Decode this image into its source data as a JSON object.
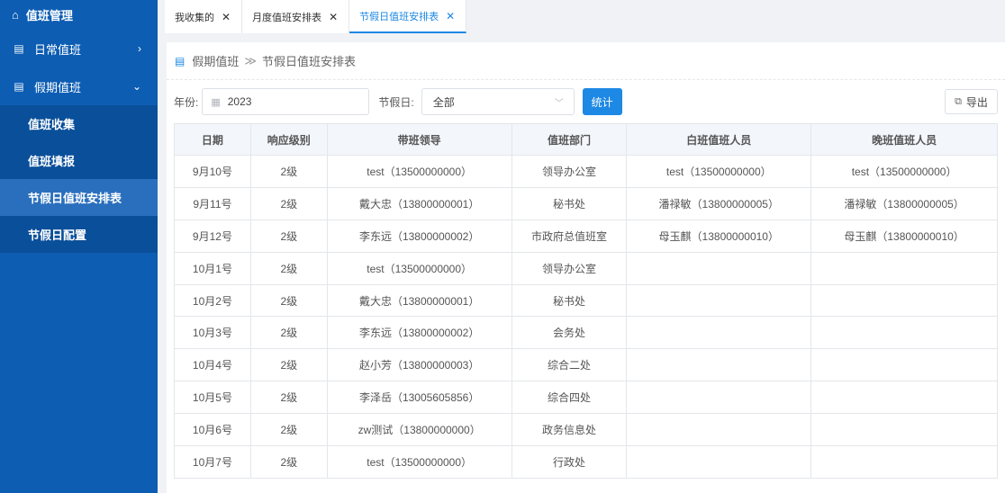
{
  "sidebar": {
    "title": "值班管理",
    "items": [
      {
        "label": "日常值班",
        "arrow": "›"
      },
      {
        "label": "假期值班",
        "arrow": "⌄"
      }
    ],
    "subitems": [
      {
        "label": "值班收集"
      },
      {
        "label": "值班填报"
      },
      {
        "label": "节假日值班安排表"
      },
      {
        "label": "节假日配置"
      }
    ]
  },
  "tabs": [
    {
      "label": "我收集的",
      "close": "✕"
    },
    {
      "label": "月度值班安排表",
      "close": "✕"
    },
    {
      "label": "节假日值班安排表",
      "close": "✕"
    }
  ],
  "breadcrumb": {
    "parent": "假期值班",
    "sep": "≫",
    "current": "节假日值班安排表"
  },
  "filters": {
    "year_label": "年份:",
    "year_value": "2023",
    "holiday_label": "节假日:",
    "holiday_value": "全部",
    "stat_button": "统计",
    "export_button": "导出"
  },
  "table": {
    "headers": [
      "日期",
      "响应级别",
      "带班领导",
      "值班部门",
      "白班值班人员",
      "晚班值班人员"
    ],
    "rows": [
      [
        "9月10号",
        "2级",
        "test（13500000000）",
        "领导办公室",
        "test（13500000000）",
        "test（13500000000）"
      ],
      [
        "9月11号",
        "2级",
        "戴大忠（13800000001）",
        "秘书处",
        "潘禄敏（13800000005）",
        "潘禄敏（13800000005）"
      ],
      [
        "9月12号",
        "2级",
        "李东远（13800000002）",
        "市政府总值班室",
        "母玉麒（13800000010）",
        "母玉麒（13800000010）"
      ],
      [
        "10月1号",
        "2级",
        "test（13500000000）",
        "领导办公室",
        "",
        ""
      ],
      [
        "10月2号",
        "2级",
        "戴大忠（13800000001）",
        "秘书处",
        "",
        ""
      ],
      [
        "10月3号",
        "2级",
        "李东远（13800000002）",
        "会务处",
        "",
        ""
      ],
      [
        "10月4号",
        "2级",
        "赵小芳（13800000003）",
        "综合二处",
        "",
        ""
      ],
      [
        "10月5号",
        "2级",
        "李泽岳（13005605856）",
        "综合四处",
        "",
        ""
      ],
      [
        "10月6号",
        "2级",
        "zw测试（13800000000）",
        "政务信息处",
        "",
        ""
      ],
      [
        "10月7号",
        "2级",
        "test（13500000000）",
        "行政处",
        "",
        ""
      ]
    ]
  }
}
